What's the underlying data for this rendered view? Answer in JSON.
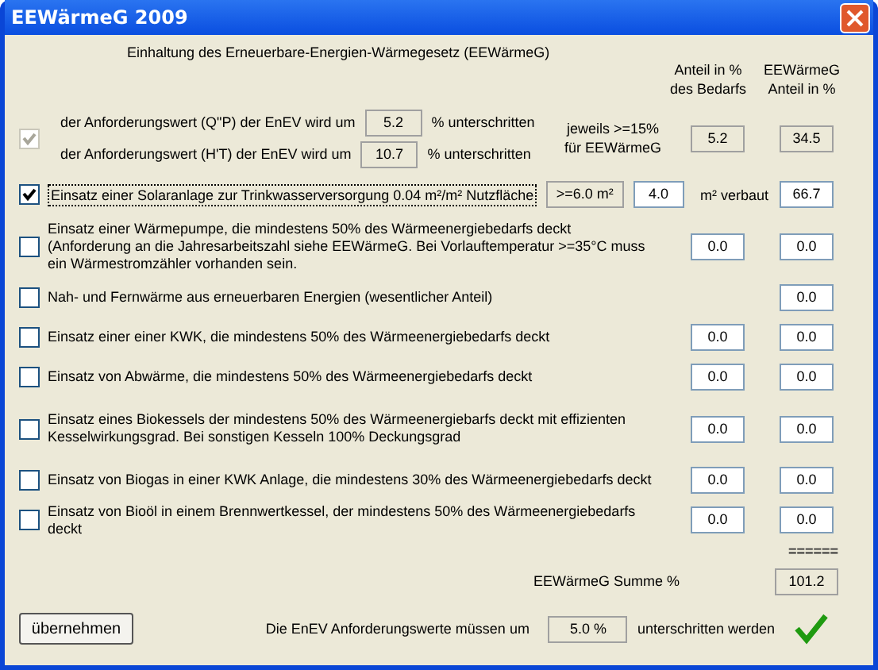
{
  "window": {
    "title": "EEWärmeG 2009"
  },
  "heading": "Einhaltung des Erneuerbare-Energien-Wärmegesetz (EEWärmeG)",
  "columns": [
    "Anteil in % des Bedarfs",
    "EEWärmeG Anteil in %"
  ],
  "measures": [
    {
      "kind": "enev",
      "checked": true,
      "disabled": true,
      "lines": [
        {
          "label": "der Anforderungswert (Q\"P) der EnEV wird um",
          "value": "5.2",
          "unit": "% unterschritten"
        },
        {
          "label": "der Anforderungswert (H'T) der EnEV wird um",
          "value": "10.7",
          "unit": "% unterschritten"
        }
      ],
      "note": "jeweils >=15% für EEWärmeG",
      "share": "5.2",
      "eewaerme": "34.5"
    },
    {
      "kind": "solar",
      "checked": true,
      "disabled": false,
      "label": "Einsatz einer Solaranlage zur Trinkwasserversorgung 0.04 m²/m² Nutzfläche",
      "requirement": ">=6.0 m²",
      "area": "4.0",
      "area_unit": "m² verbaut",
      "eewaerme": "66.7"
    },
    {
      "kind": "standard",
      "checked": false,
      "disabled": false,
      "label": "Einsatz einer Wärmepumpe, die mindestens 50% des Wärmeenergiebedarfs deckt (Anforderung an die Jahresarbeitszahl siehe EEWärmeG. Bei Vorlauftemperatur >=35°C muss ein Wärmestromzähler vorhanden sein.",
      "share": "0.0",
      "eewaerme": "0.0"
    },
    {
      "kind": "standard",
      "checked": false,
      "disabled": false,
      "label": "Nah- und Fernwärme aus erneuerbaren Energien (wesentlicher Anteil)",
      "eewaerme": "0.0"
    },
    {
      "kind": "standard",
      "checked": false,
      "disabled": false,
      "label": "Einsatz einer einer KWK, die mindestens 50% des Wärmeenergiebedarfs deckt",
      "share": "0.0",
      "eewaerme": "0.0"
    },
    {
      "kind": "standard",
      "checked": false,
      "disabled": false,
      "label": "Einsatz von Abwärme, die mindestens 50% des Wärmeenergiebedarfs deckt",
      "share": "0.0",
      "eewaerme": "0.0"
    },
    {
      "kind": "standard",
      "checked": false,
      "disabled": false,
      "label": "Einsatz eines Biokessels der mindestens 50% des Wärmeenergiebarfs deckt mit effizienten Kesselwirkungsgrad. Bei sonstigen Kesseln 100% Deckungsgrad",
      "share": "0.0",
      "eewaerme": "0.0"
    },
    {
      "kind": "standard",
      "checked": false,
      "disabled": false,
      "label": "Einsatz von Biogas in einer KWK Anlage, die mindestens 30% des Wärmeenergiebedarfs deckt",
      "share": "0.0",
      "eewaerme": "0.0"
    },
    {
      "kind": "standard",
      "checked": false,
      "disabled": false,
      "label": "Einsatz von Bioöl in einem Brennwertkessel, der mindestens 50% des Wärmeenergiebedarfs deckt",
      "share": "0.0",
      "eewaerme": "0.0"
    }
  ],
  "sum_rule": "======",
  "sum_label": "EEWärmeG Summe %",
  "sum_value": "101.2",
  "apply_button": "übernehmen",
  "requirement": {
    "prefix": "Die EnEV Anforderungswerte müssen um",
    "value": "5.0 %",
    "suffix": "unterschritten werden",
    "fulfilled": true
  }
}
